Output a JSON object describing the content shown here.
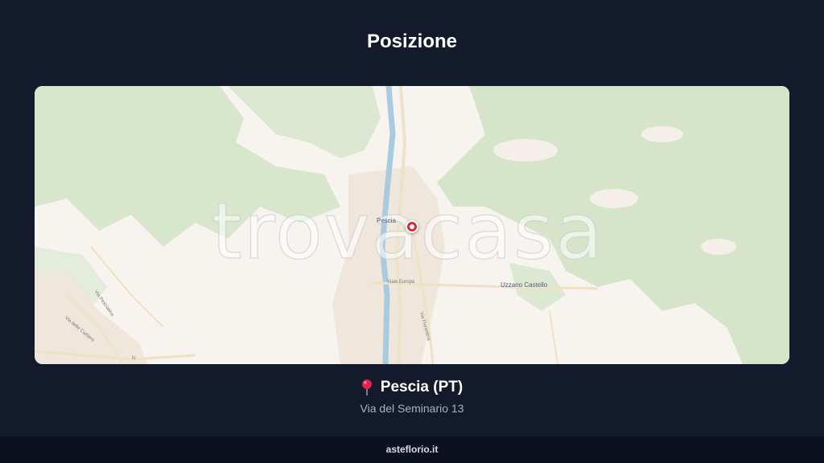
{
  "header": {
    "title": "Posizione"
  },
  "map": {
    "watermark": "trovacasa",
    "labels": {
      "town": "Pescia",
      "hamlet": "Uzzano Castello",
      "road_europa": "Viale Europa",
      "road_fiorentina": "Via Fiorentina",
      "road_cairoli": "Via delle Cartiere",
      "road_pesciatina": "Via Pesciatina",
      "road_vi": "Vi"
    },
    "colors": {
      "land": "#f7f3ee",
      "forest": "#d8e6cc",
      "river": "#a8cbe0",
      "road": "#ece3c9",
      "marker": "#d12a3a"
    }
  },
  "location": {
    "pin_icon": "map-pin-icon",
    "city": "Pescia (PT)",
    "address": "Via del Seminario 13"
  },
  "footer": {
    "brand": "asteflorio.it"
  }
}
